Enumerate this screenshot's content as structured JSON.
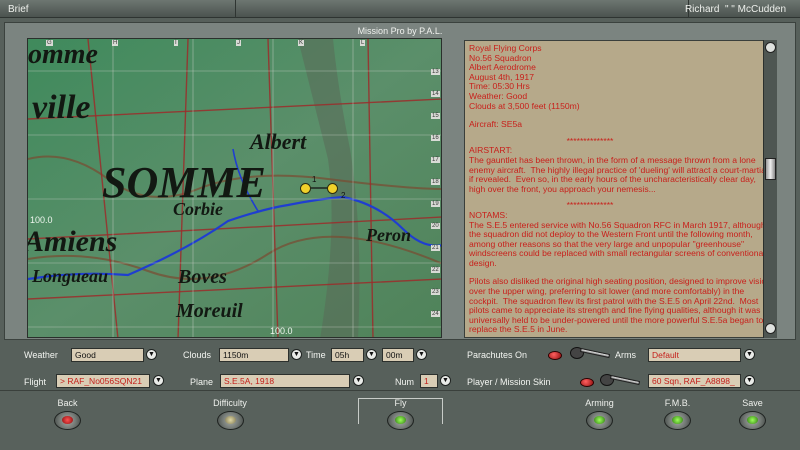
{
  "topbar": {
    "left_title": "Brief",
    "user_first": "Richard",
    "user_last": "McCudden",
    "user_separator": "\" \""
  },
  "window": {
    "title": "Mission Pro by P.A.L."
  },
  "map": {
    "grid_letters": [
      "G",
      "H",
      "I",
      "J",
      "K",
      "L"
    ],
    "grid_numbers": [
      "13",
      "14",
      "15",
      "16",
      "17",
      "18",
      "19",
      "20",
      "21",
      "22",
      "23",
      "24"
    ],
    "towns": [
      "omme",
      "ville",
      "Albert",
      "SOMME",
      "Corbie",
      "Amiens",
      "Peron",
      "Longueau",
      "Boves",
      "Moreuil"
    ],
    "coord_left": "100.0",
    "coord_bottom": "100.0",
    "waypoints": [
      "1",
      "2"
    ]
  },
  "briefing": {
    "header": "Royal Flying Corps\nNo.56 Squadron\nAlbert Aerodrome\nAugust 4th, 1917\nTime: 05:30 Hrs\nWeather: Good\nClouds at 3,500 feet (1150m)",
    "aircraft": "Aircraft: SE5a",
    "sep1": "**************",
    "airstart_title": "AIRSTART:",
    "airstart": "The gauntlet has been thrown, in the form of a message thrown from a lone enemy aircraft.  The highly illegal practice of 'dueling' will attract a court-martial if revealed.  Even so, in the early hours of the uncharacteristically clear day, high over the front, you approach your nemesis...",
    "sep2": "**************",
    "notams_title": "NOTAMS:",
    "notams": "The S.E.5 entered service with No.56 Squadron RFC in March 1917, although the squadron did not deploy to the Western Front until the following month, among other reasons so that the very large and unpopular \"greenhouse\" windscreens could be replaced with small rectangular screens of conventional design.",
    "pilots": "Pilots also disliked the original high seating position, designed to improve vision over the upper wing, preferring to sit lower (and more comfortably) in the cockpit.  The squadron flew its first patrol with the S.E.5 on April 22nd.  Most pilots came to appreciate its strength and fine flying qualities, although it was universally held to be under-powered until the more powerful S.E.5a began to replace the S.E.5 in June."
  },
  "controls": {
    "weather_label": "Weather",
    "weather_value": "Good",
    "clouds_label": "Clouds",
    "clouds_value": "1150m",
    "time_label": "Time",
    "time_hours": "05h",
    "time_minutes": "00m",
    "parachutes_label": "Parachutes On",
    "arms_label": "Arms",
    "arms_value": "Default",
    "flight_label": "Flight",
    "flight_value": "> RAF_No056SQN21",
    "plane_label": "Plane",
    "plane_value": "S.E.5A, 1918",
    "num_label": "Num",
    "num_value": "1",
    "skin_label": "Player / Mission Skin",
    "skin_value": "60 Sqn, RAF_A8898_"
  },
  "footer": {
    "back": "Back",
    "difficulty": "Difficulty",
    "fly": "Fly",
    "arming": "Arming",
    "fmb": "F.M.B.",
    "save": "Save"
  }
}
